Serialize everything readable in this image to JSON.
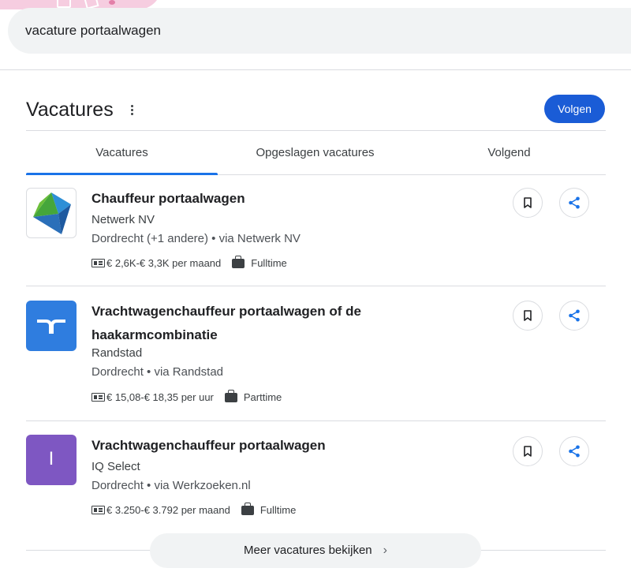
{
  "search": {
    "query": "vacature portaalwagen"
  },
  "section": {
    "title": "Vacatures",
    "follow_label": "Volgen"
  },
  "tabs": [
    {
      "label": "Vacatures",
      "active": true
    },
    {
      "label": "Opgeslagen vacatures",
      "active": false
    },
    {
      "label": "Volgend",
      "active": false
    }
  ],
  "jobs": [
    {
      "title": "Chauffeur portaalwagen",
      "company": "Netwerk NV",
      "location": "Dordrecht (+1 andere) • via Netwerk NV",
      "salary": "€ 2,6K-€ 3,3K per maand",
      "type": "Fulltime",
      "logo": "netwerk-logo"
    },
    {
      "title": "Vrachtwagenchauffeur portaalwagen of de haakarmcombinatie",
      "company": "Randstad",
      "location": "Dordrecht • via Randstad",
      "salary": "€ 15,08-€ 18,35 per uur",
      "type": "Parttime",
      "logo": "randstad-logo",
      "logo_color": "#2f7ddf"
    },
    {
      "title": "Vrachtwagenchauffeur portaalwagen",
      "company": "IQ Select",
      "location": "Dordrecht • via Werkzoeken.nl",
      "salary": "€ 3.250-€ 3.792 per maand",
      "type": "Fulltime",
      "logo": "letter-avatar",
      "logo_letter": "I",
      "logo_color": "#7e57c2"
    }
  ],
  "more": {
    "label": "Meer vacatures bekijken"
  },
  "colors": {
    "accent": "#1a5cd6",
    "tab_indicator": "#1a73e8",
    "share_icon": "#1a73e8"
  }
}
